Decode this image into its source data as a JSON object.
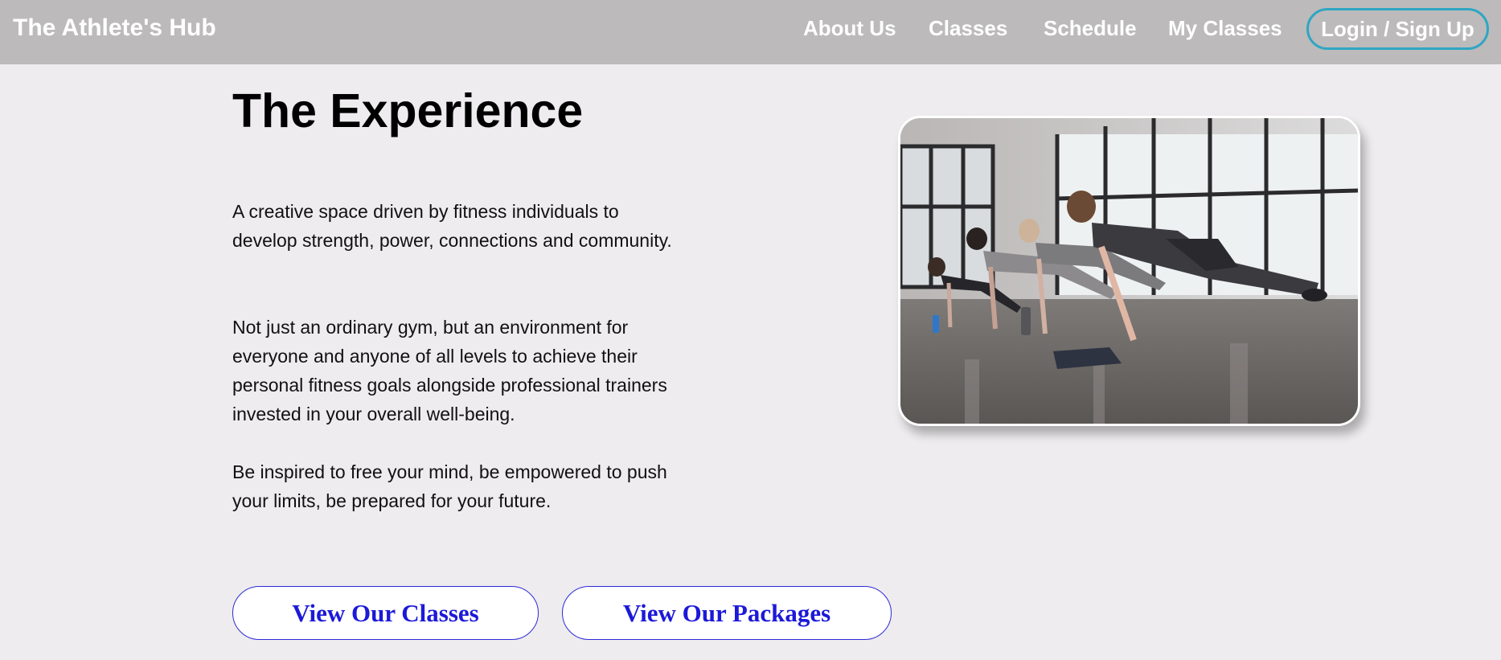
{
  "header": {
    "brand": "The Athlete's Hub",
    "nav": [
      {
        "label": "About Us"
      },
      {
        "label": "Classes"
      },
      {
        "label": "Schedule"
      },
      {
        "label": "My Classes"
      }
    ],
    "login_label": "Login / Sign Up",
    "accent_color": "#2ea6c2"
  },
  "main": {
    "title": "The Experience",
    "paragraphs": [
      "A creative space driven by fitness individuals to develop strength, power, connections and community.",
      "Not just an ordinary gym, but an environment for everyone and anyone of all levels to achieve their personal fitness goals alongside professional trainers invested in your overall well-being.",
      "Be inspired to free your mind, be empowered to push your limits, be prepared for your future."
    ],
    "image": {
      "subject": "group-pushups-photo"
    },
    "buttons": {
      "classes_label": "View Our Classes",
      "packages_label": "View Our Packages",
      "text_color": "#1c19d8"
    }
  }
}
